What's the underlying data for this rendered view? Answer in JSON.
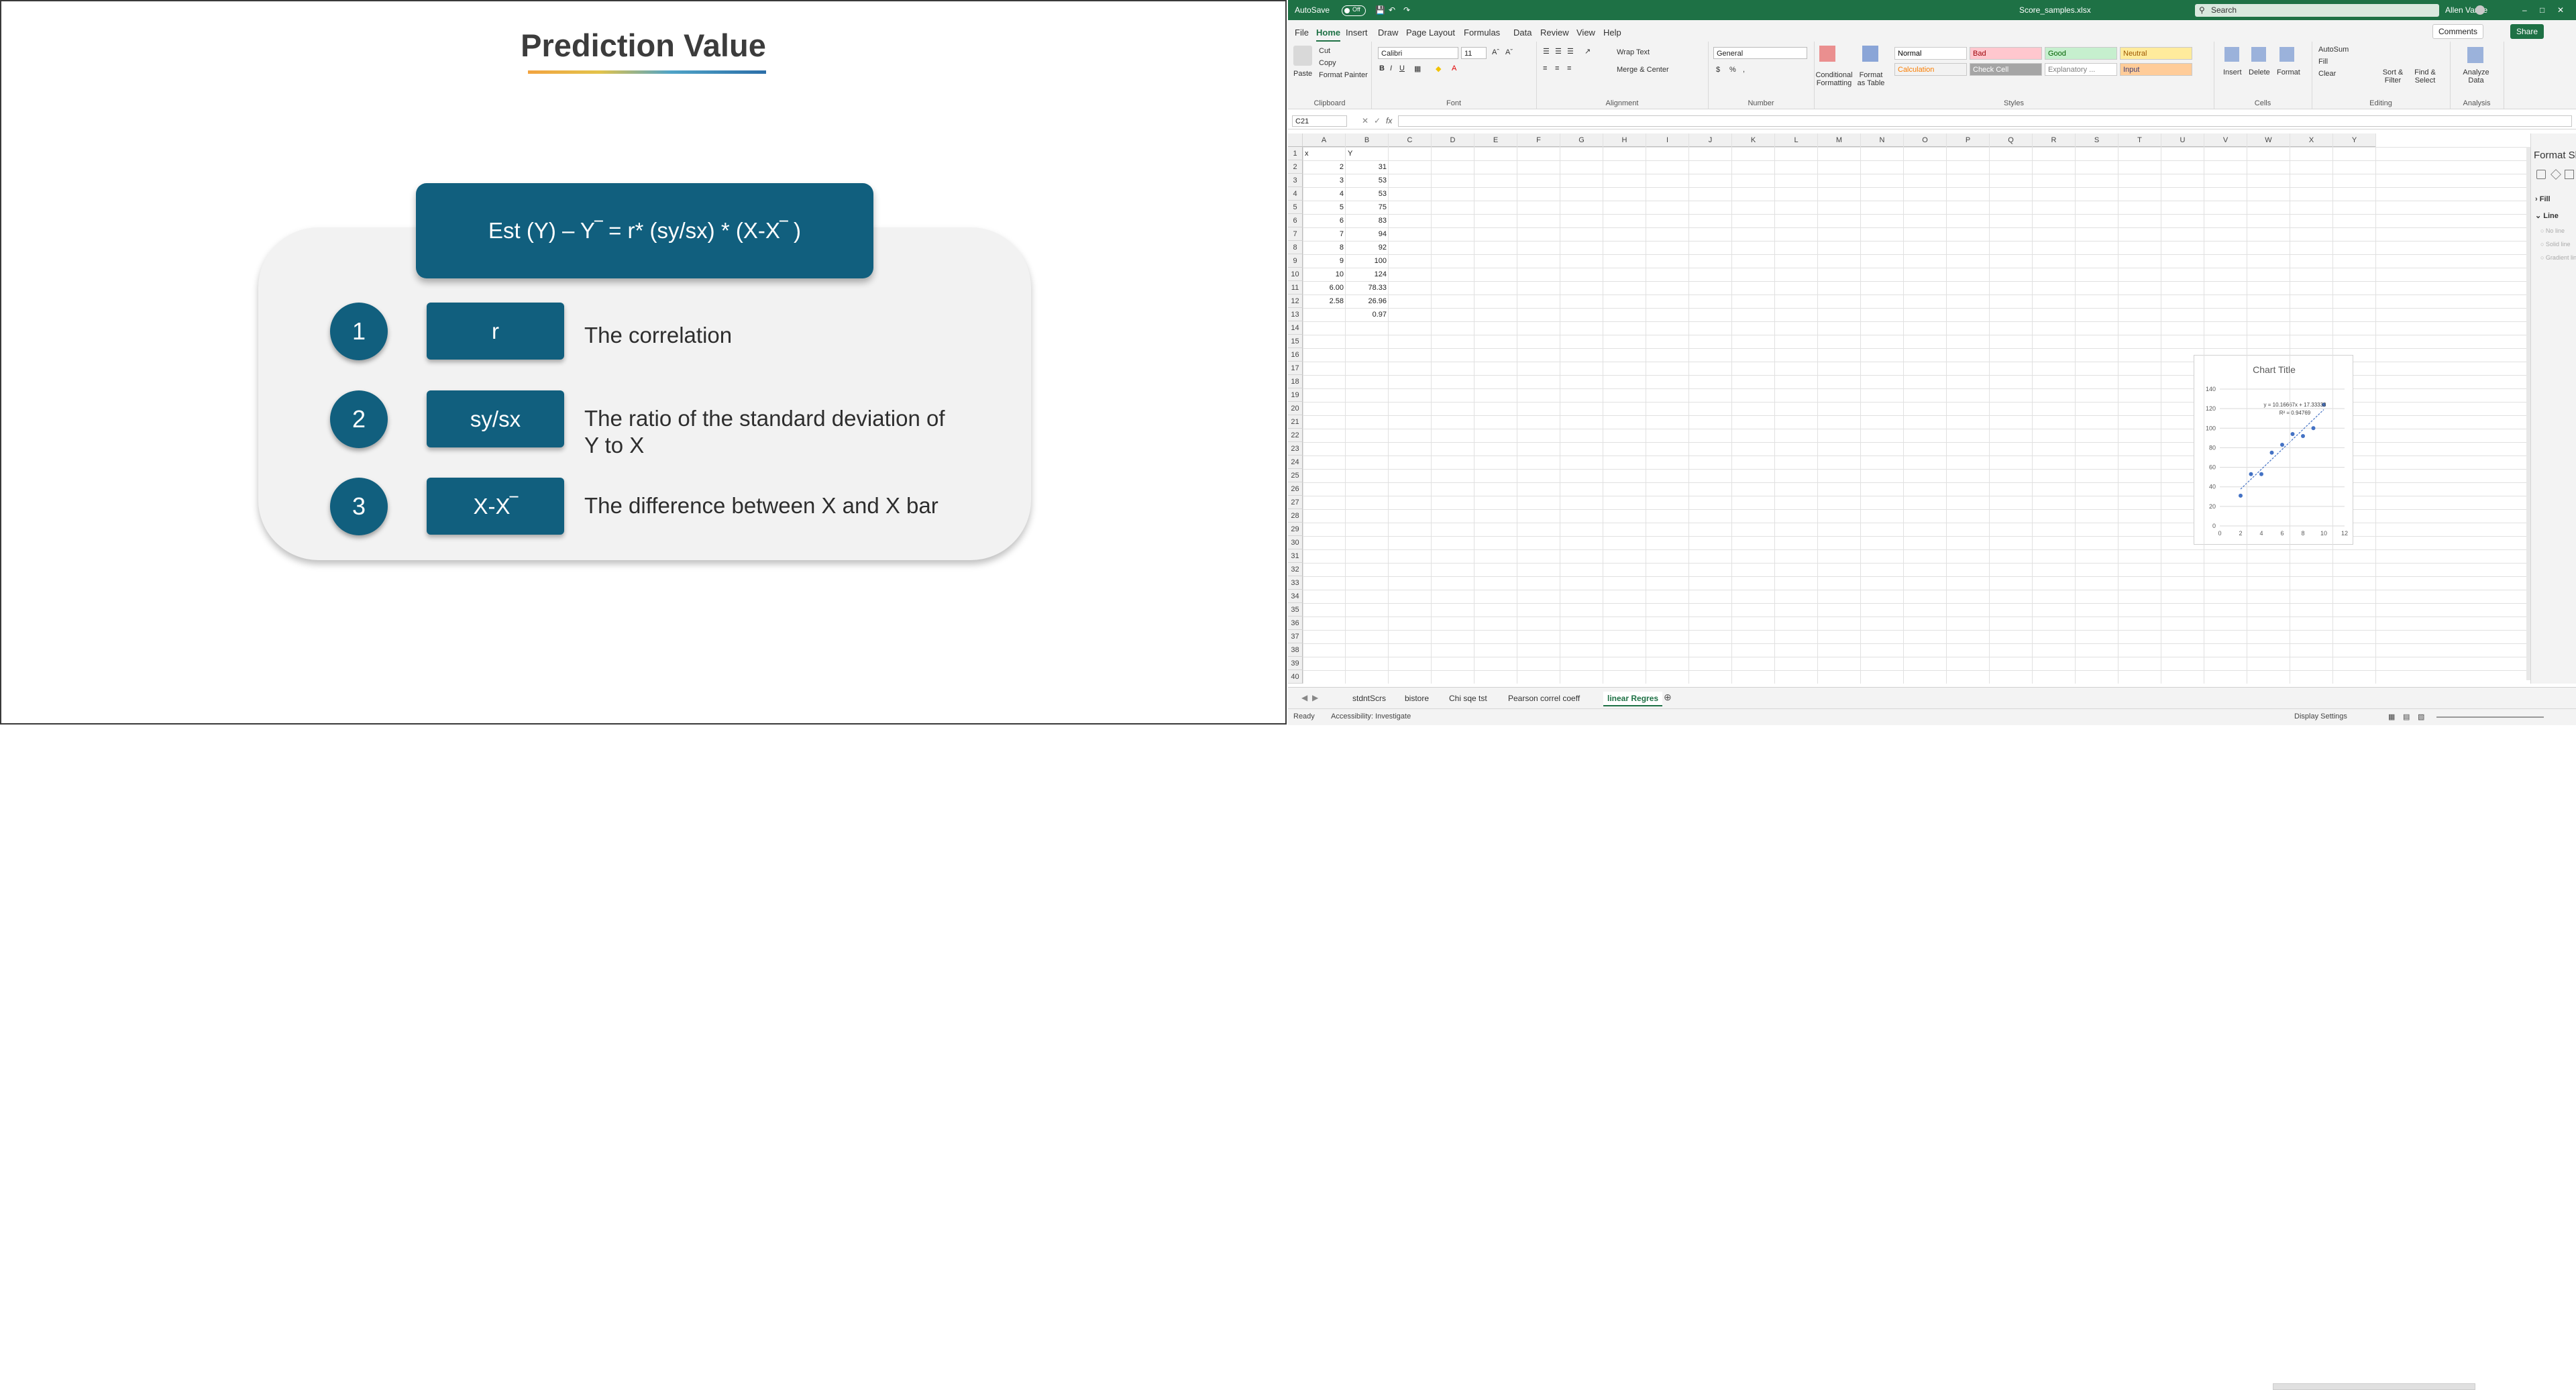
{
  "slide": {
    "title": "Prediction Value",
    "formula": "Est (Y) – Y‾ = r* (sy/sx) * (X-X‾ )",
    "items": [
      {
        "num": "1",
        "term": "r",
        "desc": "The correlation"
      },
      {
        "num": "2",
        "term": "sy/sx",
        "desc": "The ratio of the standard deviation of Y to X"
      },
      {
        "num": "3",
        "term": "X-X‾",
        "desc": "The difference between X and X bar"
      }
    ]
  },
  "excel": {
    "titlebar": {
      "autosave": "AutoSave",
      "toggle_state": "Off",
      "filename": "Score_samples.xlsx",
      "search_placeholder": "Search",
      "user": "Allen Vance"
    },
    "menu": [
      "File",
      "Home",
      "Insert",
      "Draw",
      "Page Layout",
      "Formulas",
      "Data",
      "Review",
      "View",
      "Help"
    ],
    "active_menu": "Home",
    "comments_btn": "Comments",
    "share_btn": "Share",
    "ribbon": {
      "clipboard": {
        "label": "Clipboard",
        "paste": "Paste",
        "cut": "Cut",
        "copy": "Copy",
        "format_painter": "Format Painter"
      },
      "font": {
        "label": "Font",
        "name": "Calibri",
        "size": "11"
      },
      "alignment": {
        "label": "Alignment",
        "wrap": "Wrap Text",
        "merge": "Merge & Center"
      },
      "number": {
        "label": "Number",
        "format": "General"
      },
      "styles": {
        "label": "Styles",
        "conditional": "Conditional Formatting",
        "format_table": "Format as Table",
        "cells": [
          {
            "name": "Normal",
            "bg": "#ffffff",
            "fg": "#000000"
          },
          {
            "name": "Bad",
            "bg": "#ffc7ce",
            "fg": "#9c0006"
          },
          {
            "name": "Good",
            "bg": "#c6efce",
            "fg": "#006100"
          },
          {
            "name": "Neutral",
            "bg": "#ffeb9c",
            "fg": "#9c5700"
          },
          {
            "name": "Calculation",
            "bg": "#f2f2f2",
            "fg": "#fa7d00"
          },
          {
            "name": "Check Cell",
            "bg": "#a5a5a5",
            "fg": "#ffffff"
          },
          {
            "name": "Explanatory ...",
            "bg": "#ffffff",
            "fg": "#7f7f7f"
          },
          {
            "name": "Input",
            "bg": "#ffcc99",
            "fg": "#3f3f76"
          }
        ]
      },
      "cells_grp": {
        "label": "Cells",
        "insert": "Insert",
        "delete": "Delete",
        "format": "Format"
      },
      "editing": {
        "label": "Editing",
        "autosum": "AutoSum",
        "fill": "Fill",
        "clear": "Clear",
        "sort": "Sort & Filter",
        "find": "Find & Select"
      },
      "analysis": {
        "label": "Analysis",
        "analyze": "Analyze Data"
      }
    },
    "namebox": "C21",
    "fx": "fx",
    "columns": [
      "A",
      "B",
      "C",
      "D",
      "E",
      "F",
      "G",
      "H",
      "I",
      "J",
      "K",
      "L",
      "M",
      "N",
      "O",
      "P",
      "Q",
      "R",
      "S",
      "T",
      "U",
      "V",
      "W",
      "X",
      "Y"
    ],
    "rows": [
      "1",
      "2",
      "3",
      "4",
      "5",
      "6",
      "7",
      "8",
      "9",
      "10",
      "11",
      "12",
      "13",
      "14",
      "15",
      "16",
      "17",
      "18",
      "19",
      "20",
      "21",
      "22",
      "23",
      "24",
      "25",
      "26",
      "27",
      "28",
      "29",
      "30",
      "31",
      "32",
      "33",
      "34",
      "35",
      "36",
      "37",
      "38",
      "39",
      "40"
    ],
    "cells": [
      {
        "r": 1,
        "A": "x",
        "B": "Y"
      },
      {
        "r": 2,
        "A": "2",
        "B": "31"
      },
      {
        "r": 3,
        "A": "3",
        "B": "53"
      },
      {
        "r": 4,
        "A": "4",
        "B": "53"
      },
      {
        "r": 5,
        "A": "5",
        "B": "75"
      },
      {
        "r": 6,
        "A": "6",
        "B": "83"
      },
      {
        "r": 7,
        "A": "7",
        "B": "94"
      },
      {
        "r": 8,
        "A": "8",
        "B": "92"
      },
      {
        "r": 9,
        "A": "9",
        "B": "100"
      },
      {
        "r": 10,
        "A": "10",
        "B": "124"
      },
      {
        "r": 11,
        "A": "6.00",
        "B": "78.33"
      },
      {
        "r": 12,
        "A": "2.58",
        "B": "26.96"
      },
      {
        "r": 13,
        "A": "",
        "B": "0.97"
      }
    ],
    "chart": {
      "title": "Chart Title",
      "equation": "y = 10.16667x + 17.33333",
      "r2": "R² = 0.94769",
      "x_ticks": [
        "0",
        "2",
        "4",
        "6",
        "8",
        "10",
        "12"
      ],
      "y_ticks": [
        "0",
        "20",
        "40",
        "60",
        "80",
        "100",
        "120",
        "140"
      ],
      "xlim": [
        0,
        12
      ],
      "ylim": [
        0,
        140
      ],
      "points": [
        [
          2,
          31
        ],
        [
          3,
          53
        ],
        [
          4,
          53
        ],
        [
          5,
          75
        ],
        [
          6,
          83
        ],
        [
          7,
          94
        ],
        [
          8,
          92
        ],
        [
          9,
          100
        ],
        [
          10,
          124
        ]
      ],
      "trend": {
        "slope": 10.16667,
        "intercept": 17.33333
      },
      "color": "#4472c4"
    },
    "format_pane": {
      "title": "Format Shape",
      "sections": [
        "Fill",
        "Line"
      ],
      "line_options": [
        "No line",
        "Solid line",
        "Gradient line"
      ]
    },
    "sheets": [
      "stdntScrs",
      "bistore",
      "Chi sqe tst",
      "Pearson correl coeff",
      "linear Regres"
    ],
    "active_sheet": "linear Regres",
    "status": {
      "ready": "Ready",
      "accessibility": "Accessibility: Investigate",
      "display": "Display Settings"
    }
  }
}
